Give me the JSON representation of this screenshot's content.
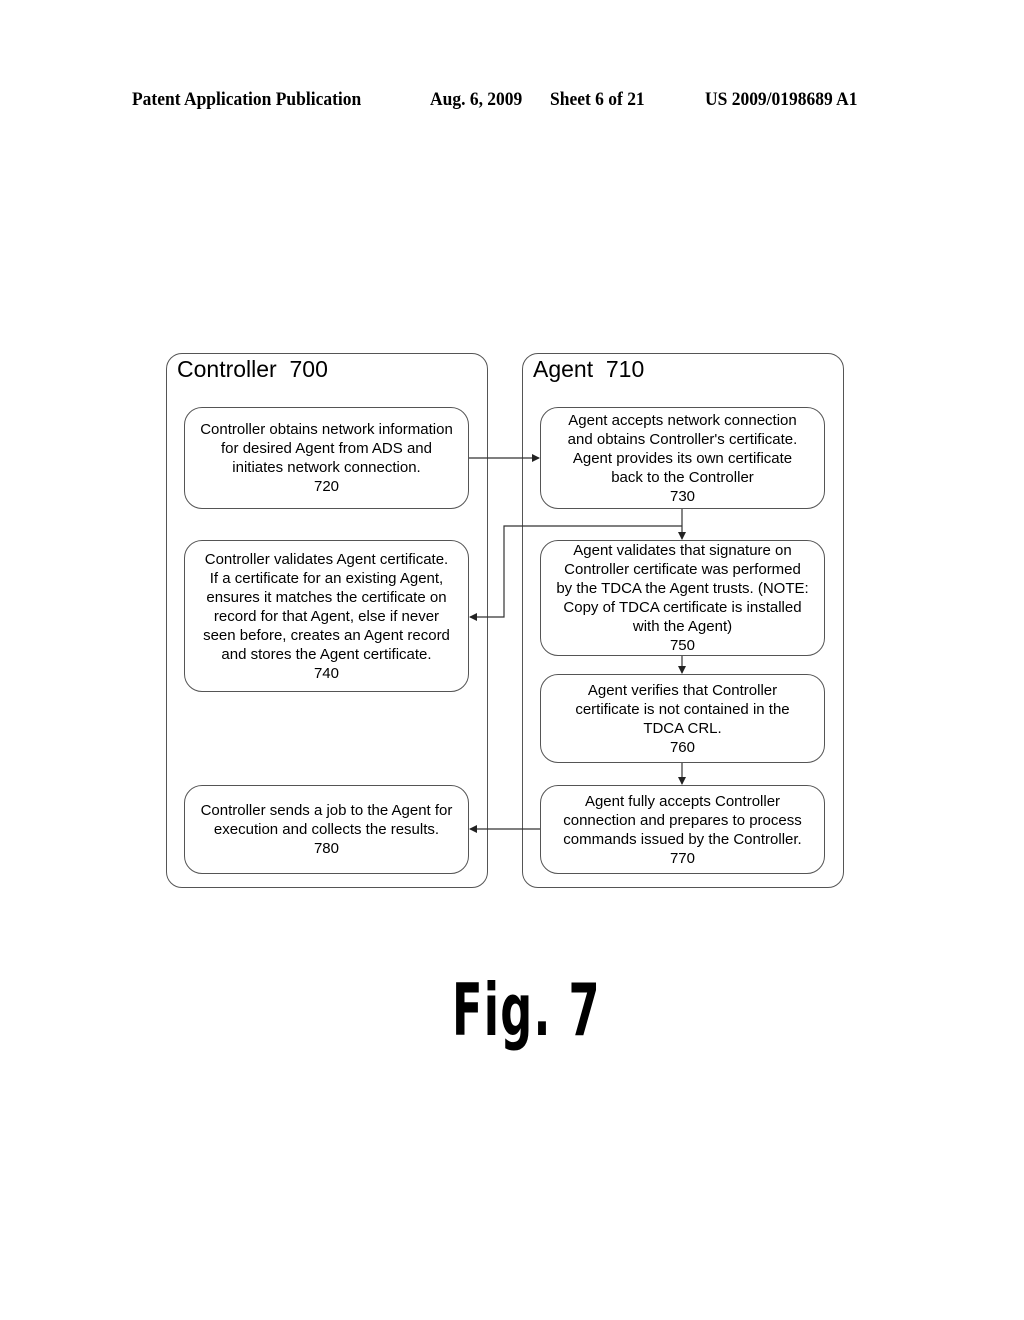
{
  "header": {
    "publication": "Patent Application Publication",
    "date": "Aug. 6, 2009",
    "sheet": "Sheet 6 of 21",
    "number": "US 2009/0198689 A1"
  },
  "lanes": {
    "controller": {
      "title": "Controller  700"
    },
    "agent": {
      "title": "Agent  710"
    }
  },
  "steps": {
    "s720": {
      "lines": [
        "Controller obtains network information",
        "for desired Agent from ADS and",
        "initiates network connection."
      ],
      "ref": "720"
    },
    "s730": {
      "lines": [
        "Agent accepts network connection",
        "and obtains Controller's certificate.",
        "Agent provides its own certificate",
        "back to the Controller"
      ],
      "ref": "730"
    },
    "s740": {
      "lines": [
        "Controller validates Agent certificate.",
        "If a certificate for an existing Agent,",
        "ensures it matches the certificate on",
        "record for that Agent, else if never",
        "seen before, creates an Agent record",
        "and stores the Agent certificate."
      ],
      "ref": "740"
    },
    "s750": {
      "lines": [
        "Agent validates that signature on",
        "Controller certificate was performed",
        "by the TDCA the Agent trusts. (NOTE:",
        "Copy of TDCA certificate is installed",
        "with the Agent)"
      ],
      "ref": "750"
    },
    "s760": {
      "lines": [
        "Agent verifies that Controller",
        "certificate is not contained in the",
        "TDCA CRL."
      ],
      "ref": "760"
    },
    "s770": {
      "lines": [
        "Agent fully accepts Controller",
        "connection and prepares to process",
        "commands issued by the Controller."
      ],
      "ref": "770"
    },
    "s780": {
      "lines": [
        "Controller sends a job to the Agent for",
        "execution and collects the results."
      ],
      "ref": "780"
    }
  },
  "figure_label": "Fig. 7"
}
